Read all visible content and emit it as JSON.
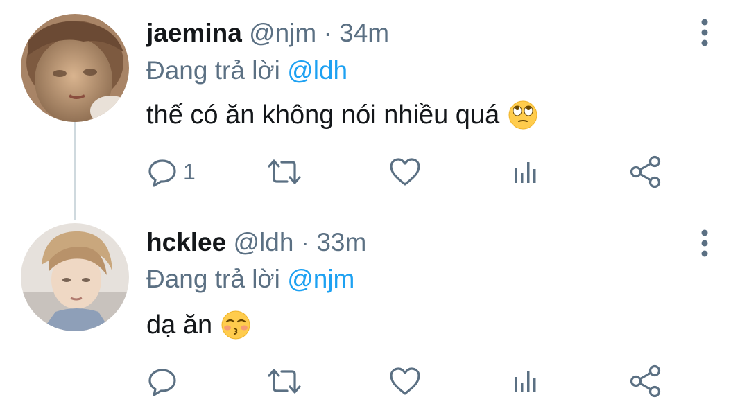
{
  "tweets": [
    {
      "display_name": "jaemina",
      "handle": "@njm",
      "separator": "·",
      "time": "34m",
      "reply_prefix": "Đang trả lời",
      "reply_to": "@ldh",
      "text": "thế có ăn không nói nhiều quá",
      "emoji": "face-with-rolling-eyes",
      "reply_count": "1",
      "icons": {
        "reply": "reply-icon",
        "retweet": "retweet-icon",
        "like": "heart-icon",
        "stats": "stats-icon",
        "share": "share-icon",
        "more": "more-vertical-icon"
      }
    },
    {
      "display_name": "hcklee",
      "handle": "@ldh",
      "separator": "·",
      "time": "33m",
      "reply_prefix": "Đang trả lời",
      "reply_to": "@njm",
      "text": "dạ ăn",
      "emoji": "kissing-face-with-closed-eyes",
      "reply_count": "",
      "icons": {
        "reply": "reply-icon",
        "retweet": "retweet-icon",
        "like": "heart-icon",
        "stats": "stats-icon",
        "share": "share-icon",
        "more": "more-vertical-icon"
      }
    }
  ],
  "colors": {
    "text": "#14171a",
    "secondary": "#5b7083",
    "link": "#1da1f2",
    "thread_line": "#cfd9de",
    "background": "#ffffff"
  }
}
